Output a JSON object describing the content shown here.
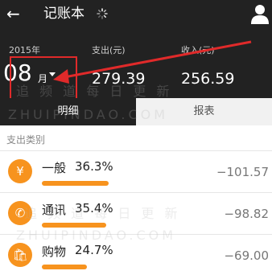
{
  "header": {
    "title": "记账本"
  },
  "summary": {
    "year": "2015年",
    "month_number": "08",
    "month_suffix": "月",
    "expense_label": "支出(元)",
    "expense_value": "279.39",
    "income_label": "收入(元)",
    "income_value": "256.59"
  },
  "tabs": [
    {
      "label": "明细"
    },
    {
      "label": "报表"
    }
  ],
  "section_title": "支出类别",
  "categories": [
    {
      "name": "一般",
      "percent": "36.3%",
      "amount": "−101.57",
      "icon": "yen-icon",
      "glyph": "¥",
      "share": 0.363
    },
    {
      "name": "通讯",
      "percent": "35.4%",
      "amount": "−98.82",
      "icon": "phone-icon",
      "glyph": "✆",
      "share": 0.354
    },
    {
      "name": "购物",
      "percent": "24.7%",
      "amount": "−69.00",
      "icon": "shopping-bag-icon",
      "glyph": "🛍",
      "share": 0.247
    }
  ],
  "watermarks": [
    "ZHUIPINDAO.COM",
    "追 频 道 每 日 更 新",
    "ZHUIPINDAO.COM",
    "追 频 道 每 日 更 新"
  ],
  "colors": {
    "header_bg": "#222222",
    "accent": "#f7931e",
    "annotation": "#e02a2a"
  }
}
